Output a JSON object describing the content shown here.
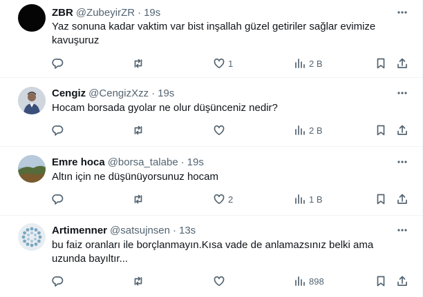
{
  "colors": {
    "text": "#0f1419",
    "secondary": "#536471",
    "divider": "#eff3f4"
  },
  "tweets": [
    {
      "name": "ZBR",
      "handle": "@ZubeyirZR",
      "separator": "·",
      "time": "19s",
      "text": "Yaz sonuna kadar vaktim var bist inşallah güzel getiriler sağlar evimize kavuşuruz",
      "avatar": "black-circle-avatar",
      "likes": "1",
      "views": "2 B"
    },
    {
      "name": "Cengiz",
      "handle": "@CengizXzz",
      "separator": "·",
      "time": "19s",
      "text": "Hocam borsada gyolar ne olur düşünceniz nedir?",
      "avatar": "person-photo-avatar",
      "likes": "",
      "views": "2 B"
    },
    {
      "name": "Emre hoca",
      "handle": "@borsa_talabe",
      "separator": "·",
      "time": "19s",
      "text": "Altın için ne düşünüyorsunuz hocam",
      "avatar": "landscape-photo-avatar",
      "likes": "2",
      "views": "1 B"
    },
    {
      "name": "Artimenner",
      "handle": "@satsujnsen",
      "separator": "·",
      "time": "13s",
      "text": "bu faiz oranları ile borçlanmayın.Kısa vade de anlamazsınız belki ama uzunda bayıltır...",
      "avatar": "default-dots-avatar",
      "likes": "",
      "views": "898"
    }
  ],
  "icons": [
    "more-icon",
    "reply-icon",
    "retweet-icon",
    "like-icon",
    "views-icon",
    "bookmark-icon",
    "share-icon"
  ]
}
